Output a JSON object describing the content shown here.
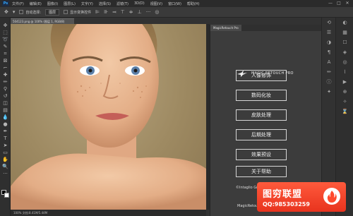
{
  "app": {
    "logo": "Ps"
  },
  "menu": [
    "文件(F)",
    "编辑(E)",
    "图像(I)",
    "图层(L)",
    "文字(Y)",
    "选择(S)",
    "滤镜(T)",
    "3D(D)",
    "视图(V)",
    "窗口(W)",
    "帮助(H)"
  ],
  "window_controls": [
    "—",
    "□",
    "✕"
  ],
  "options_bar": {
    "auto_select_label": "自动选择:",
    "auto_select_value": "图层",
    "transform_label": "显示变换控件"
  },
  "document_tab": "504123.png @ 100% (图层 1, RGB/8)",
  "status_bar": "100%    文档:8.41M/5.44M",
  "panel": {
    "tab_label": "MagicRetouch Pro",
    "plugin_name": "MAGIC RETOUCH PRO",
    "buttons": [
      "人像修饰",
      "数码化妆",
      "皮肤处理",
      "后期处理",
      "效果预设",
      "关于帮助"
    ],
    "copyright": "©Intaglio Graphics",
    "footer": "MagicRetouchPro"
  },
  "watermark": {
    "title": "图穷联盟",
    "qq": "QQ:985303259"
  },
  "colors": {
    "button_border": "#d6d6d6",
    "watermark": "#ff4a2e"
  }
}
